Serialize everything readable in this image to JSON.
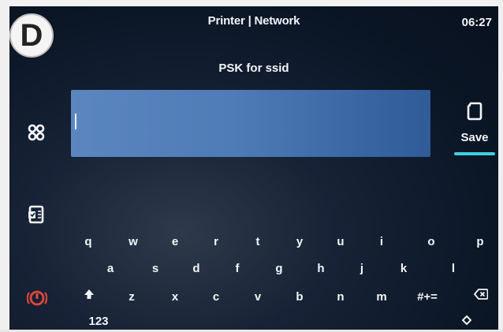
{
  "badge": {
    "letter": "D"
  },
  "header": {
    "title": "Printer | Network",
    "clock": "06:27"
  },
  "prompt": "PSK for ssid",
  "input": {
    "value": ""
  },
  "save": {
    "label": "Save"
  },
  "icons": {
    "apps": "apps-grid-icon",
    "document": "document-icon",
    "power": "power-alert-icon",
    "save": "save-document-icon",
    "shift": "shift-icon",
    "backspace": "backspace-icon",
    "hide_keyboard": "hide-keyboard-icon"
  },
  "keyboard": {
    "row1": [
      "q",
      "w",
      "e",
      "r",
      "t",
      "y",
      "u",
      "i",
      "o",
      "p"
    ],
    "row2": [
      "a",
      "s",
      "d",
      "f",
      "g",
      "h",
      "j",
      "k",
      "l"
    ],
    "row3": [
      "z",
      "x",
      "c",
      "v",
      "b",
      "n",
      "m"
    ],
    "symbols_label": "#+=",
    "numbers_label": "123"
  },
  "colors": {
    "screen_bg": "#0b1626",
    "input_bg": "#4f7bb6",
    "accent": "#3fd0df",
    "alert": "#e0463b",
    "text": "#f3f5f8"
  }
}
